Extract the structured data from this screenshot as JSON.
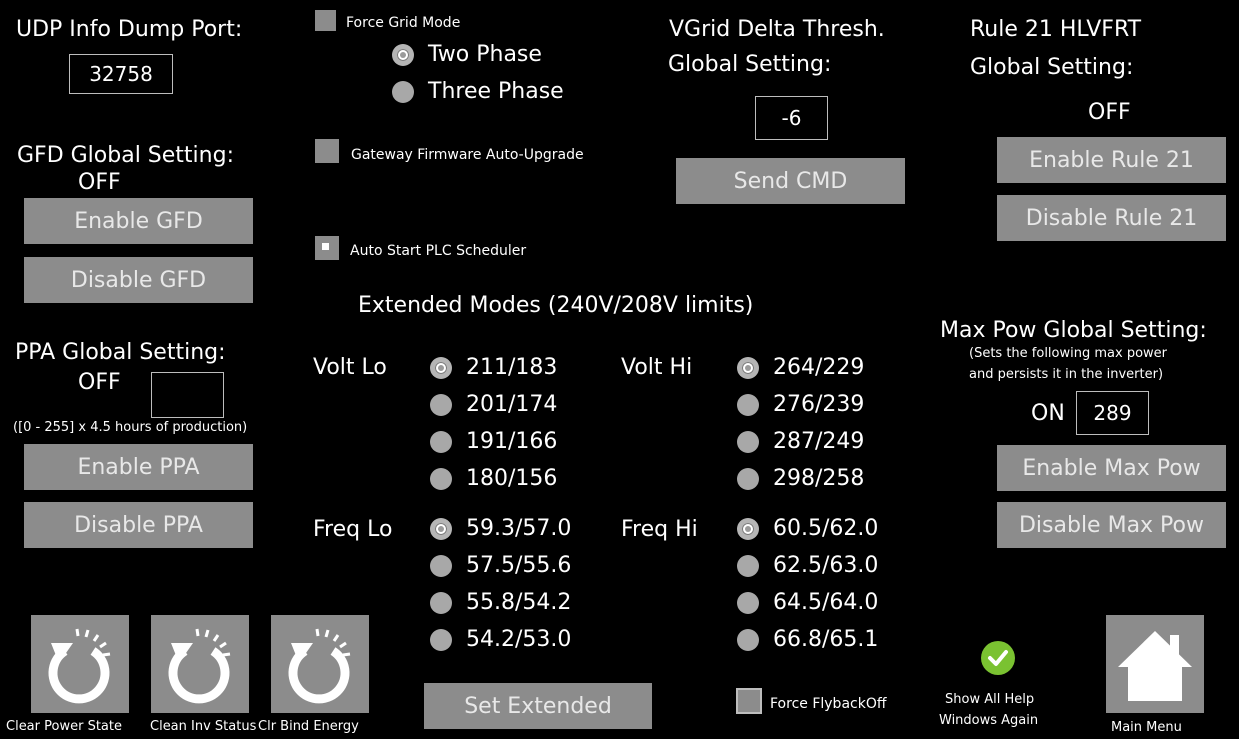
{
  "udp": {
    "label": "UDP Info Dump Port:",
    "port": "32758"
  },
  "gfd": {
    "label": "GFD Global Setting:",
    "status": "OFF",
    "enable": "Enable GFD",
    "disable": "Disable GFD"
  },
  "ppa": {
    "label": "PPA Global Setting:",
    "status": "OFF",
    "value": "",
    "note": "([0 - 255] x 4.5 hours of production)",
    "enable": "Enable PPA",
    "disable": "Disable PPA"
  },
  "grid": {
    "force_label": "Force Grid Mode",
    "two_phase": "Two Phase",
    "three_phase": "Three Phase"
  },
  "gateway": {
    "label": "Gateway Firmware Auto-Upgrade"
  },
  "plc": {
    "label": "Auto Start PLC Scheduler"
  },
  "vgrid": {
    "line1": "VGrid Delta Thresh.",
    "line2": "Global Setting:",
    "value": "-6",
    "send": "Send CMD"
  },
  "rule21": {
    "line1": "Rule 21 HLVFRT",
    "line2": "Global Setting:",
    "status": "OFF",
    "enable": "Enable Rule 21",
    "disable": "Disable Rule 21"
  },
  "extended": {
    "title": "Extended Modes (240V/208V limits)",
    "volt_lo": {
      "label": "Volt Lo",
      "options": [
        "211/183",
        "201/174",
        "191/166",
        "180/156"
      ]
    },
    "volt_hi": {
      "label": "Volt Hi",
      "options": [
        "264/229",
        "276/239",
        "287/249",
        "298/258"
      ]
    },
    "freq_lo": {
      "label": "Freq Lo",
      "options": [
        "59.3/57.0",
        "57.5/55.6",
        "55.8/54.2",
        "54.2/53.0"
      ]
    },
    "freq_hi": {
      "label": "Freq Hi",
      "options": [
        "60.5/62.0",
        "62.5/63.0",
        "64.5/64.0",
        "66.8/65.1"
      ]
    },
    "set": "Set Extended"
  },
  "maxpow": {
    "title": "Max Pow Global Setting:",
    "desc1": "(Sets the following max power",
    "desc2": "and persists it in the inverter)",
    "status": "ON",
    "value": "289",
    "enable": "Enable Max Pow",
    "disable": "Disable Max Pow"
  },
  "flyback": {
    "label": "Force FlybackOff"
  },
  "help": {
    "line1": "Show All Help",
    "line2": "Windows Again"
  },
  "tiles": {
    "clear_power": "Clear Power State",
    "clean_inv": "Clean Inv Status",
    "clr_bind": "Clr Bind Energy",
    "main_menu": "Main Menu"
  },
  "colors": {
    "button_gray": "#8c8c8c",
    "help_green": "#7ac231"
  }
}
